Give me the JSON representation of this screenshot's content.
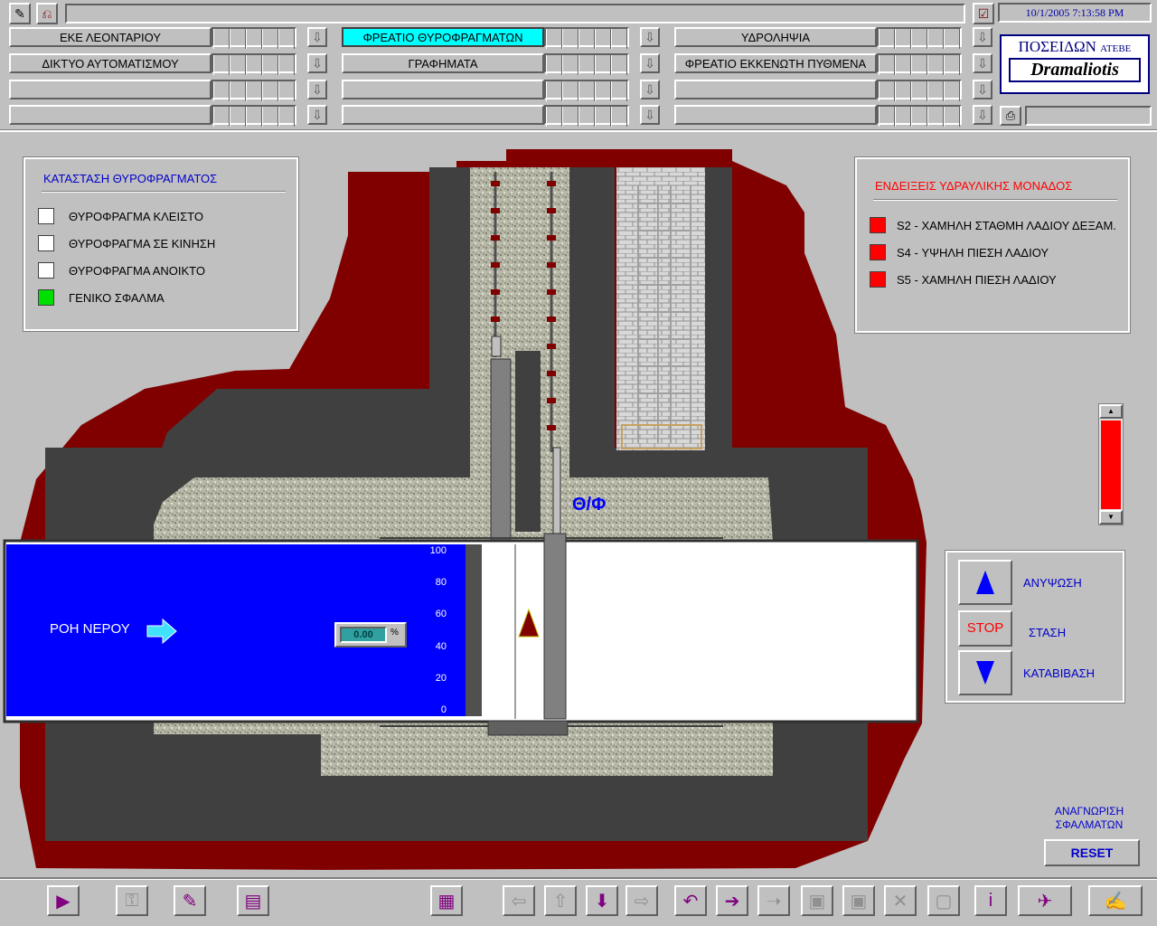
{
  "header": {
    "datetime": "10/1/2005 7:13:58 PM",
    "nav_rows": [
      [
        "ΕΚΕ ΛΕΟΝΤΑΡΙΟΥ",
        "ΦΡΕΑΤΙΟ ΘΥΡΟΦΡΑΓΜΑΤΩΝ",
        "ΥΔΡΟΛΗΨΙΑ"
      ],
      [
        "ΔΙΚΤΥΟ ΑΥΤΟΜΑΤΙΣΜΟΥ",
        "ΓΡΑΦΗΜΑΤΑ",
        "ΦΡΕΑΤΙΟ ΕΚΚΕΝΩΤΗ ΠΥΘΜΕΝΑ"
      ],
      [
        "",
        "",
        ""
      ],
      [
        "",
        "",
        ""
      ]
    ],
    "active_nav": "ΦΡΕΑΤΙΟ ΘΥΡΟΦΡΑΓΜΑΤΩΝ",
    "logo_top": "ΠΟΣΕΙΔΩΝ",
    "logo_top_suffix": "ΑΤΕΒΕ",
    "logo_bottom": "Dramaliotis"
  },
  "gate_status": {
    "title": "ΚΑΤΑΣΤΑΣΗ ΘΥΡΟΦΡΑΓΜΑΤΟΣ",
    "items": [
      {
        "label": "ΘΥΡΟΦΡΑΓΜΑ ΚΛΕΙΣΤΟ",
        "color": "#ffffff"
      },
      {
        "label": "ΘΥΡΟΦΡΑΓΜΑ ΣΕ ΚΙΝΗΣΗ",
        "color": "#ffffff"
      },
      {
        "label": "ΘΥΡΟΦΡΑΓΜΑ ΑΝΟΙΚΤΟ",
        "color": "#ffffff"
      },
      {
        "label": "ΓΕΝΙΚΟ ΣΦΑΛΜΑ",
        "color": "#00e000"
      }
    ]
  },
  "hydraulic": {
    "title": "ΕΝΔΕΙΞΕΙΣ ΥΔΡΑΥΛΙΚΗΣ ΜΟΝΑΔΟΣ",
    "items": [
      {
        "label": "S2 - ΧΑΜΗΛΗ ΣΤΑΘΜΗ ΛΑΔΙΟΥ ΔΕΞΑΜ.",
        "color": "#ff0000"
      },
      {
        "label": "S4 - ΥΨΗΛΗ ΠΙΕΣΗ ΛΑΔΙΟΥ",
        "color": "#ff0000"
      },
      {
        "label": "S5 - ΧΑΜΗΛΗ ΠΙΕΣΗ ΛΑΔΙΟΥ",
        "color": "#ff0000"
      }
    ]
  },
  "scene": {
    "water_flow_label": "ΡΟΗ ΝΕΡΟΥ",
    "gate_label": "Θ/Φ",
    "opening_value": "0.00",
    "opening_unit": "%",
    "scale_ticks": [
      "100",
      "80",
      "60",
      "40",
      "20",
      "0"
    ]
  },
  "controls": {
    "raise_label": "ΑΝΥΨΩΣΗ",
    "stop_button": "STOP",
    "stop_label": "ΣΤΑΣΗ",
    "lower_label": "ΚΑΤΑΒΙΒΑΣΗ"
  },
  "fault_ack": {
    "label_line1": "ΑΝΑΓΝΩΡΙΣΗ",
    "label_line2": "ΣΦΑΛΜΑΤΩΝ",
    "reset_button": "RESET"
  },
  "colors": {
    "water": "#0000ff",
    "earth": "#800000",
    "concrete": "#404040",
    "alarm_red": "#ff0000",
    "ok_green": "#00e000",
    "active_nav": "#00ffff",
    "label_blue": "#0000cc"
  },
  "toolbar_icons": [
    "play-icon",
    "key-icon",
    "new-file-icon",
    "print-setup-icon",
    "clipboard-icon",
    "arrow-left-icon",
    "arrow-up-icon",
    "arrow-down-icon",
    "arrow-right-icon",
    "undo-icon",
    "step-into-icon",
    "step-over-icon",
    "window-icon",
    "windows-icon",
    "close-window-icon",
    "computer-icon",
    "info-icon",
    "plane-icon",
    "signature-icon"
  ]
}
